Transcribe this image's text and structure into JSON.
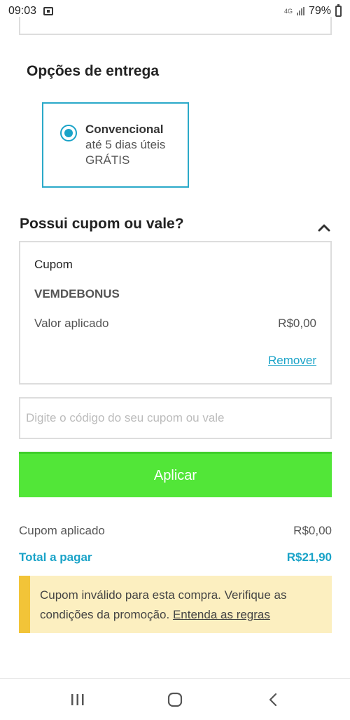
{
  "status_bar": {
    "time": "09:03",
    "network": "4G",
    "battery": "79%"
  },
  "delivery": {
    "title": "Opções de entrega",
    "option": {
      "name": "Convencional",
      "eta": "até 5 dias úteis",
      "price": "GRÁTIS",
      "selected": true
    }
  },
  "coupon": {
    "title": "Possui cupom ou vale?",
    "card": {
      "label": "Cupom",
      "code": "VEMDEBONUS",
      "value_label": "Valor aplicado",
      "value": "R$0,00",
      "remove_label": "Remover"
    },
    "input": {
      "placeholder": "Digite o código do seu cupom ou vale",
      "value": ""
    },
    "apply_label": "Aplicar"
  },
  "summary": {
    "applied_label": "Cupom aplicado",
    "applied_value": "R$0,00",
    "total_label": "Total a pagar",
    "total_value": "R$21,90"
  },
  "alert": {
    "message": "Cupom inválido para esta compra. Verifique as condições da promoção.",
    "link": "Entenda as regras"
  },
  "colors": {
    "accent": "#1aa3c8",
    "apply_button": "#52e638",
    "alert_bg": "#fcefc0",
    "alert_border": "#f2c438"
  },
  "icons": {
    "notification": "notification-icon",
    "signal": "signal-icon",
    "battery": "battery-icon",
    "collapse": "chevron-up-icon",
    "nav_recents": "recents-icon",
    "nav_home": "home-icon",
    "nav_back": "back-icon"
  }
}
